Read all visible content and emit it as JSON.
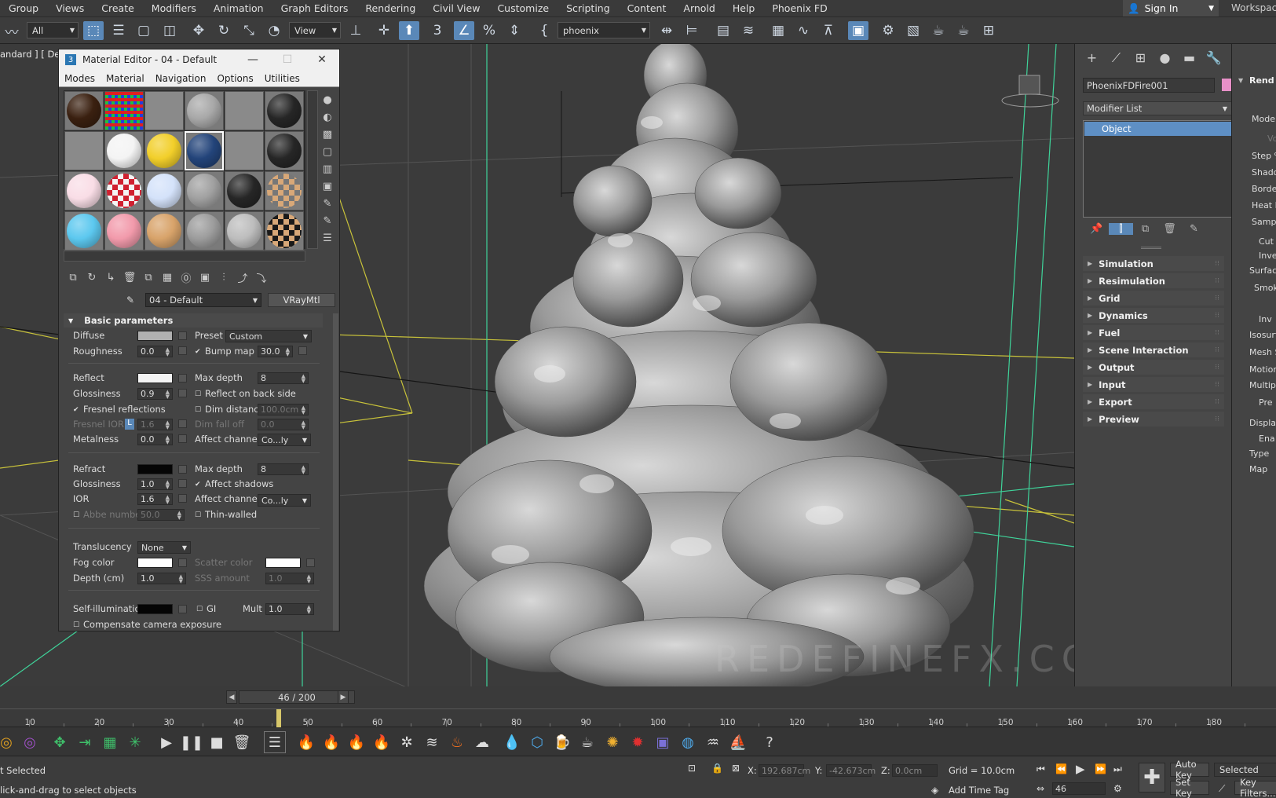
{
  "menubar": {
    "items": [
      "Group",
      "Views",
      "Create",
      "Modifiers",
      "Animation",
      "Graph Editors",
      "Rendering",
      "Civil View",
      "Customize",
      "Scripting",
      "Content",
      "Arnold",
      "Help",
      "Phoenix FD"
    ],
    "signin": "Sign In",
    "workspaces": "Workspaces"
  },
  "toolbar": {
    "selection_filter": "All",
    "ref_coord": "View",
    "named_selection": "phoenix"
  },
  "viewport": {
    "label": "andard ] [ Defa",
    "watermark": "REDEFINEFX.COM"
  },
  "material_editor": {
    "title": "Material Editor - 04 - Default",
    "menus": [
      "Modes",
      "Material",
      "Navigation",
      "Options",
      "Utilities"
    ],
    "slots": [
      {
        "color": "#3a2010",
        "shape": "ball"
      },
      {
        "color": "checker-rgb",
        "shape": "flat"
      },
      {
        "color": "#8a8a8a",
        "shape": "flat"
      },
      {
        "color": "#a8a8a8",
        "shape": "ball"
      },
      {
        "color": "#8a8a8a",
        "shape": "flat"
      },
      {
        "color": "#262626",
        "shape": "ball"
      },
      {
        "color": "#8a8a8a",
        "shape": "flat"
      },
      {
        "color": "#f4f4f4",
        "shape": "ball"
      },
      {
        "color": "#f2cf2a",
        "shape": "ball"
      },
      {
        "color": "#23447a",
        "shape": "ball"
      },
      {
        "color": "#8a8a8a",
        "shape": "flat"
      },
      {
        "color": "#262626",
        "shape": "ball"
      },
      {
        "color": "#f9dde6",
        "shape": "ball"
      },
      {
        "color": "checker-red",
        "shape": "ball"
      },
      {
        "color": "#d4e2fa",
        "shape": "ball"
      },
      {
        "color": "#a0a0a0",
        "shape": "ball"
      },
      {
        "color": "#262626",
        "shape": "ball"
      },
      {
        "color": "checker-tan",
        "shape": "ball"
      },
      {
        "color": "#5cc8ef",
        "shape": "ball"
      },
      {
        "color": "#f29aab",
        "shape": "ball"
      },
      {
        "color": "#d8a36a",
        "shape": "ball"
      },
      {
        "color": "#9c9c9c",
        "shape": "ball"
      },
      {
        "color": "#bdbdbd",
        "shape": "ball"
      },
      {
        "color": "checker-dark",
        "shape": "ball"
      }
    ],
    "material_name": "04 - Default",
    "material_type": "VRayMtl",
    "rollout": "Basic parameters",
    "diffuse": {
      "label": "Diffuse",
      "color": "#b0b0b0"
    },
    "roughness": {
      "label": "Roughness",
      "value": "0.0"
    },
    "preset": {
      "label": "Preset",
      "value": "Custom"
    },
    "bump_map": {
      "label": "Bump map",
      "value": "30.0"
    },
    "reflect": {
      "label": "Reflect",
      "color": "#f4f4f4"
    },
    "refl_max_depth": {
      "label": "Max depth",
      "value": "8"
    },
    "refl_glossiness": {
      "label": "Glossiness",
      "value": "0.9"
    },
    "reflect_back": "Reflect on back side",
    "fresnel": "Fresnel reflections",
    "dim_distance": {
      "label": "Dim distance",
      "value": "100.0cm"
    },
    "fresnel_ior": {
      "label": "Fresnel IOR",
      "value": "1.6",
      "lock": "L"
    },
    "dim_falloff": {
      "label": "Dim fall off",
      "value": "0.0"
    },
    "metalness": {
      "label": "Metalness",
      "value": "0.0"
    },
    "affect_channels_1": {
      "label": "Affect channels",
      "value": "Co...ly"
    },
    "refract": {
      "label": "Refract",
      "color": "#050505"
    },
    "refr_max_depth": {
      "label": "Max depth",
      "value": "8"
    },
    "refr_glossiness": {
      "label": "Glossiness",
      "value": "1.0"
    },
    "affect_shadows": "Affect shadows",
    "ior": {
      "label": "IOR",
      "value": "1.6"
    },
    "affect_channels_2": {
      "label": "Affect channels",
      "value": "Co...ly"
    },
    "abbe": {
      "label": "Abbe number",
      "value": "50.0"
    },
    "thin_walled": "Thin-walled",
    "translucency": {
      "label": "Translucency",
      "value": "None"
    },
    "fog_color": {
      "label": "Fog color",
      "color": "#ffffff"
    },
    "scatter_color": {
      "label": "Scatter color",
      "color": "#ffffff"
    },
    "depth": {
      "label": "Depth (cm)",
      "value": "1.0"
    },
    "sss_amount": {
      "label": "SSS amount",
      "value": "1.0"
    },
    "self_illum": {
      "label": "Self-illumination",
      "color": "#050505"
    },
    "gi": "GI",
    "mult": {
      "label": "Mult",
      "value": "1.0"
    },
    "comp_camera": "Compensate camera exposure"
  },
  "command_panel": {
    "object_name": "PhoenixFDFire001",
    "object_color": "#e890c8",
    "modifier_list": "Modifier List",
    "stack_item": "Object",
    "rollouts": [
      "Simulation",
      "Resimulation",
      "Grid",
      "Dynamics",
      "Fuel",
      "Scene Interaction",
      "Output",
      "Input",
      "Export",
      "Preview"
    ]
  },
  "right_panel": {
    "title": "Rend",
    "labels": [
      "Mode",
      "Vo",
      "Step %",
      "Shadow",
      "Border",
      "Heat H",
      "Sample",
      "Cut",
      "Inve",
      "Surfac",
      "Smok",
      "Inv",
      "Isosurf",
      "Mesh S",
      "Motion",
      "Multip",
      "Pre",
      "Displa",
      "Ena",
      "Type",
      "Map"
    ]
  },
  "timeline": {
    "frame": "46 / 200",
    "ticks": [
      "10",
      "20",
      "30",
      "40",
      "50",
      "60",
      "70",
      "80",
      "90",
      "100",
      "110",
      "120",
      "130",
      "140",
      "150",
      "160",
      "170",
      "180"
    ],
    "current_frame": 46,
    "total_frames": 200
  },
  "status": {
    "selection": "t Selected",
    "prompt": "lick-and-drag to select objects",
    "x_label": "X:",
    "x_value": "192.687cm",
    "y_label": "Y:",
    "y_value": "-42.673cm",
    "z_label": "Z:",
    "z_value": "0.0cm",
    "grid": "Grid = 10.0cm",
    "add_time_tag": "Add Time Tag",
    "auto_key": "Auto Key",
    "selected": "Selected",
    "set_key": "Set Key",
    "key_filters": "Key Filters...",
    "frame_field": "46"
  }
}
